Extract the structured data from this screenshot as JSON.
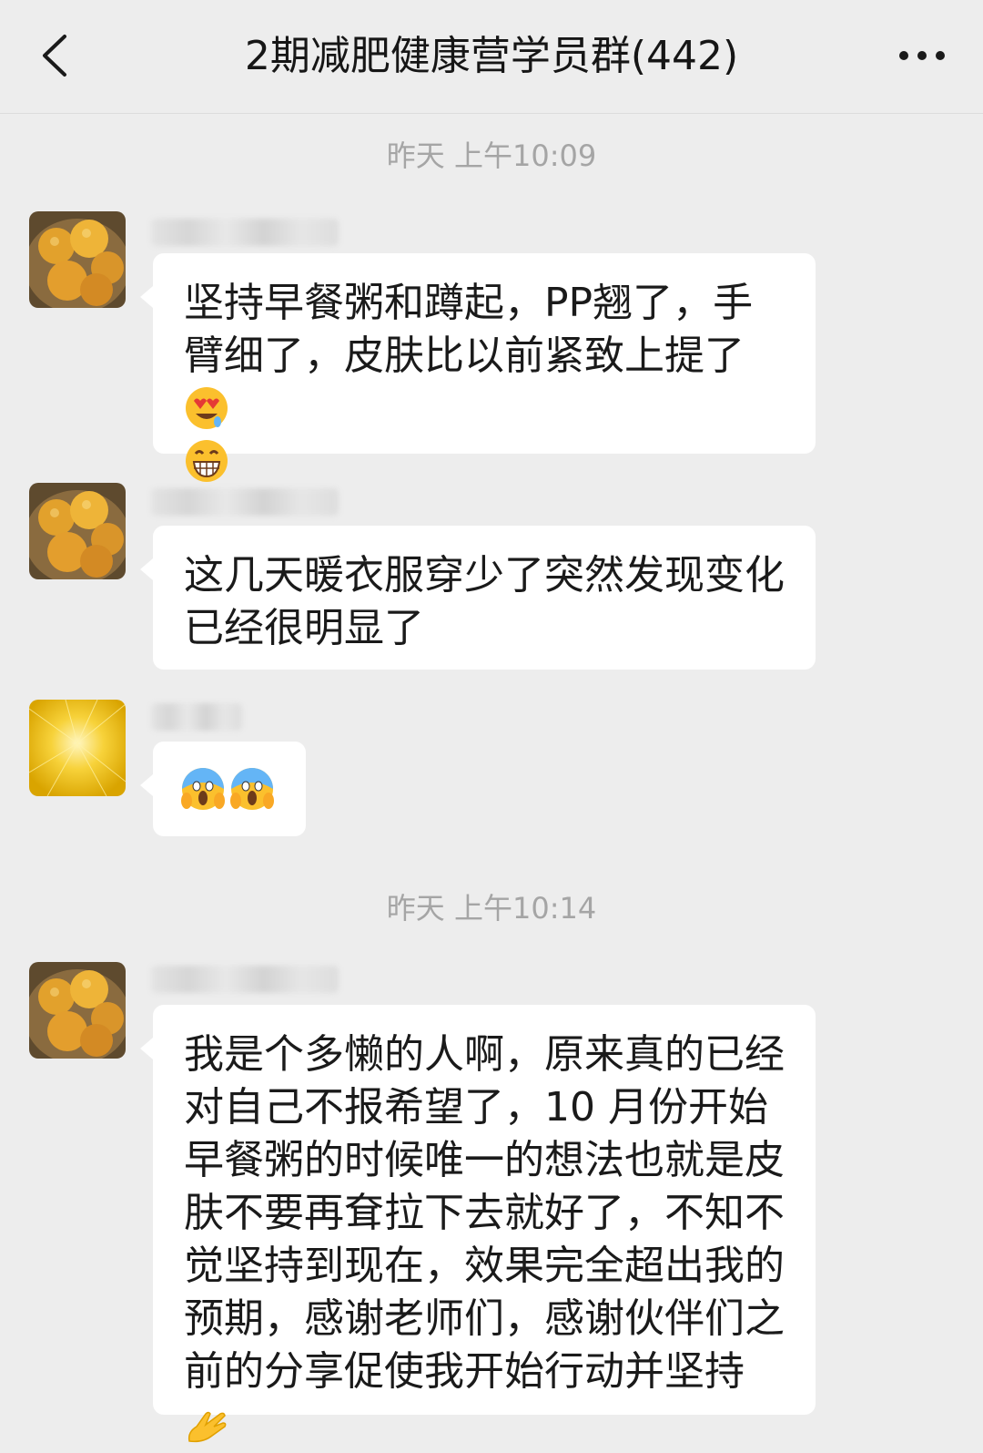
{
  "header": {
    "title": "2期减肥健康营学员群(442)",
    "back_icon": "chevron-left-icon",
    "more_icon": "more-dots-icon"
  },
  "timestamps": {
    "first": "昨天 上午10:09",
    "second": "昨天 上午10:14"
  },
  "messages": [
    {
      "avatar": "fruit-avatar",
      "text_lines": [
        "坚持早餐粥和蹲起，PP翘了，手",
        "臂细了，皮肤比以前紧致上提了"
      ],
      "emojis": [
        "heart-eyes-emoji",
        "grinning-emoji"
      ]
    },
    {
      "avatar": "fruit-avatar",
      "text_lines": [
        "这几天暖衣服穿少了突然发现变化",
        "已经很明显了"
      ]
    },
    {
      "avatar": "golden-texture-avatar",
      "emojis": [
        "screaming-face-emoji",
        "screaming-face-emoji"
      ]
    },
    {
      "avatar": "fruit-avatar",
      "text_lines": [
        "我是个多懒的人啊，原来真的已经",
        "对自己不报希望了，10 月份开始",
        "早餐粥的时候唯一的想法也就是皮",
        "肤不要再耷拉下去就好了，不知不",
        "觉坚持到现在，效果完全超出我的",
        "预期，感谢老师们，感谢伙伴们之",
        "前的分享促使我开始行动并坚持"
      ],
      "emojis": [
        "ok-hand-emoji"
      ]
    }
  ],
  "colors": {
    "background": "#ededed",
    "bubble": "#ffffff",
    "timestamp": "#a5a5a5"
  }
}
